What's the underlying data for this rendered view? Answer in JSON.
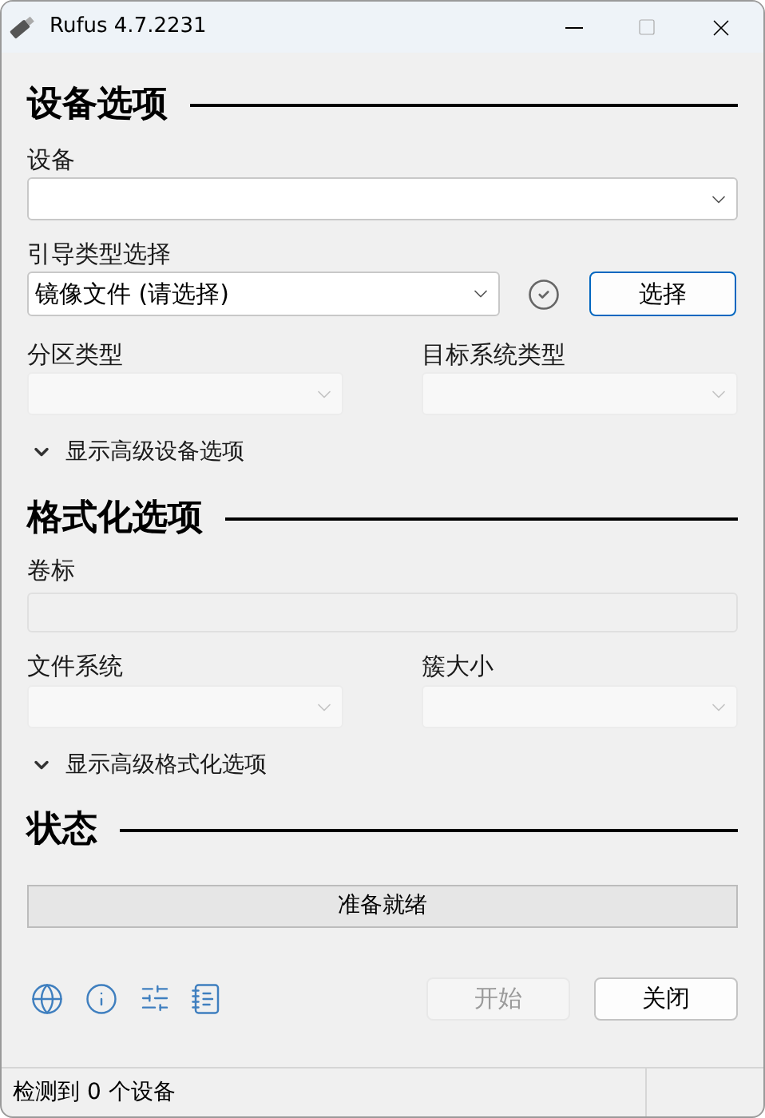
{
  "window": {
    "title": "Rufus 4.7.2231"
  },
  "device_options": {
    "heading": "设备选项",
    "device": {
      "label": "设备",
      "disabled": false
    },
    "boot_selection": {
      "label": "引导类型选择",
      "value": "镜像文件 (请选择)",
      "button": "选择"
    },
    "partition_scheme": {
      "label": "分区类型",
      "disabled": true
    },
    "target_system": {
      "label": "目标系统类型",
      "disabled": true
    },
    "advanced_toggle": {
      "label": "显示高级设备选项",
      "expanded": false
    }
  },
  "format_options": {
    "heading": "格式化选项",
    "volume_label": {
      "label": "卷标",
      "disabled": true
    },
    "file_system": {
      "label": "文件系统",
      "disabled": true
    },
    "cluster_size": {
      "label": "簇大小",
      "disabled": true
    },
    "advanced_toggle": {
      "label": "显示高级格式化选项",
      "expanded": false
    }
  },
  "status": {
    "heading": "状态",
    "progress_text": "准备就绪"
  },
  "buttons": [
    {
      "label": "开始",
      "disabled": true
    },
    {
      "label": "关闭",
      "disabled": false
    }
  ],
  "status_bar": {
    "text": "检测到 0 个设备"
  }
}
